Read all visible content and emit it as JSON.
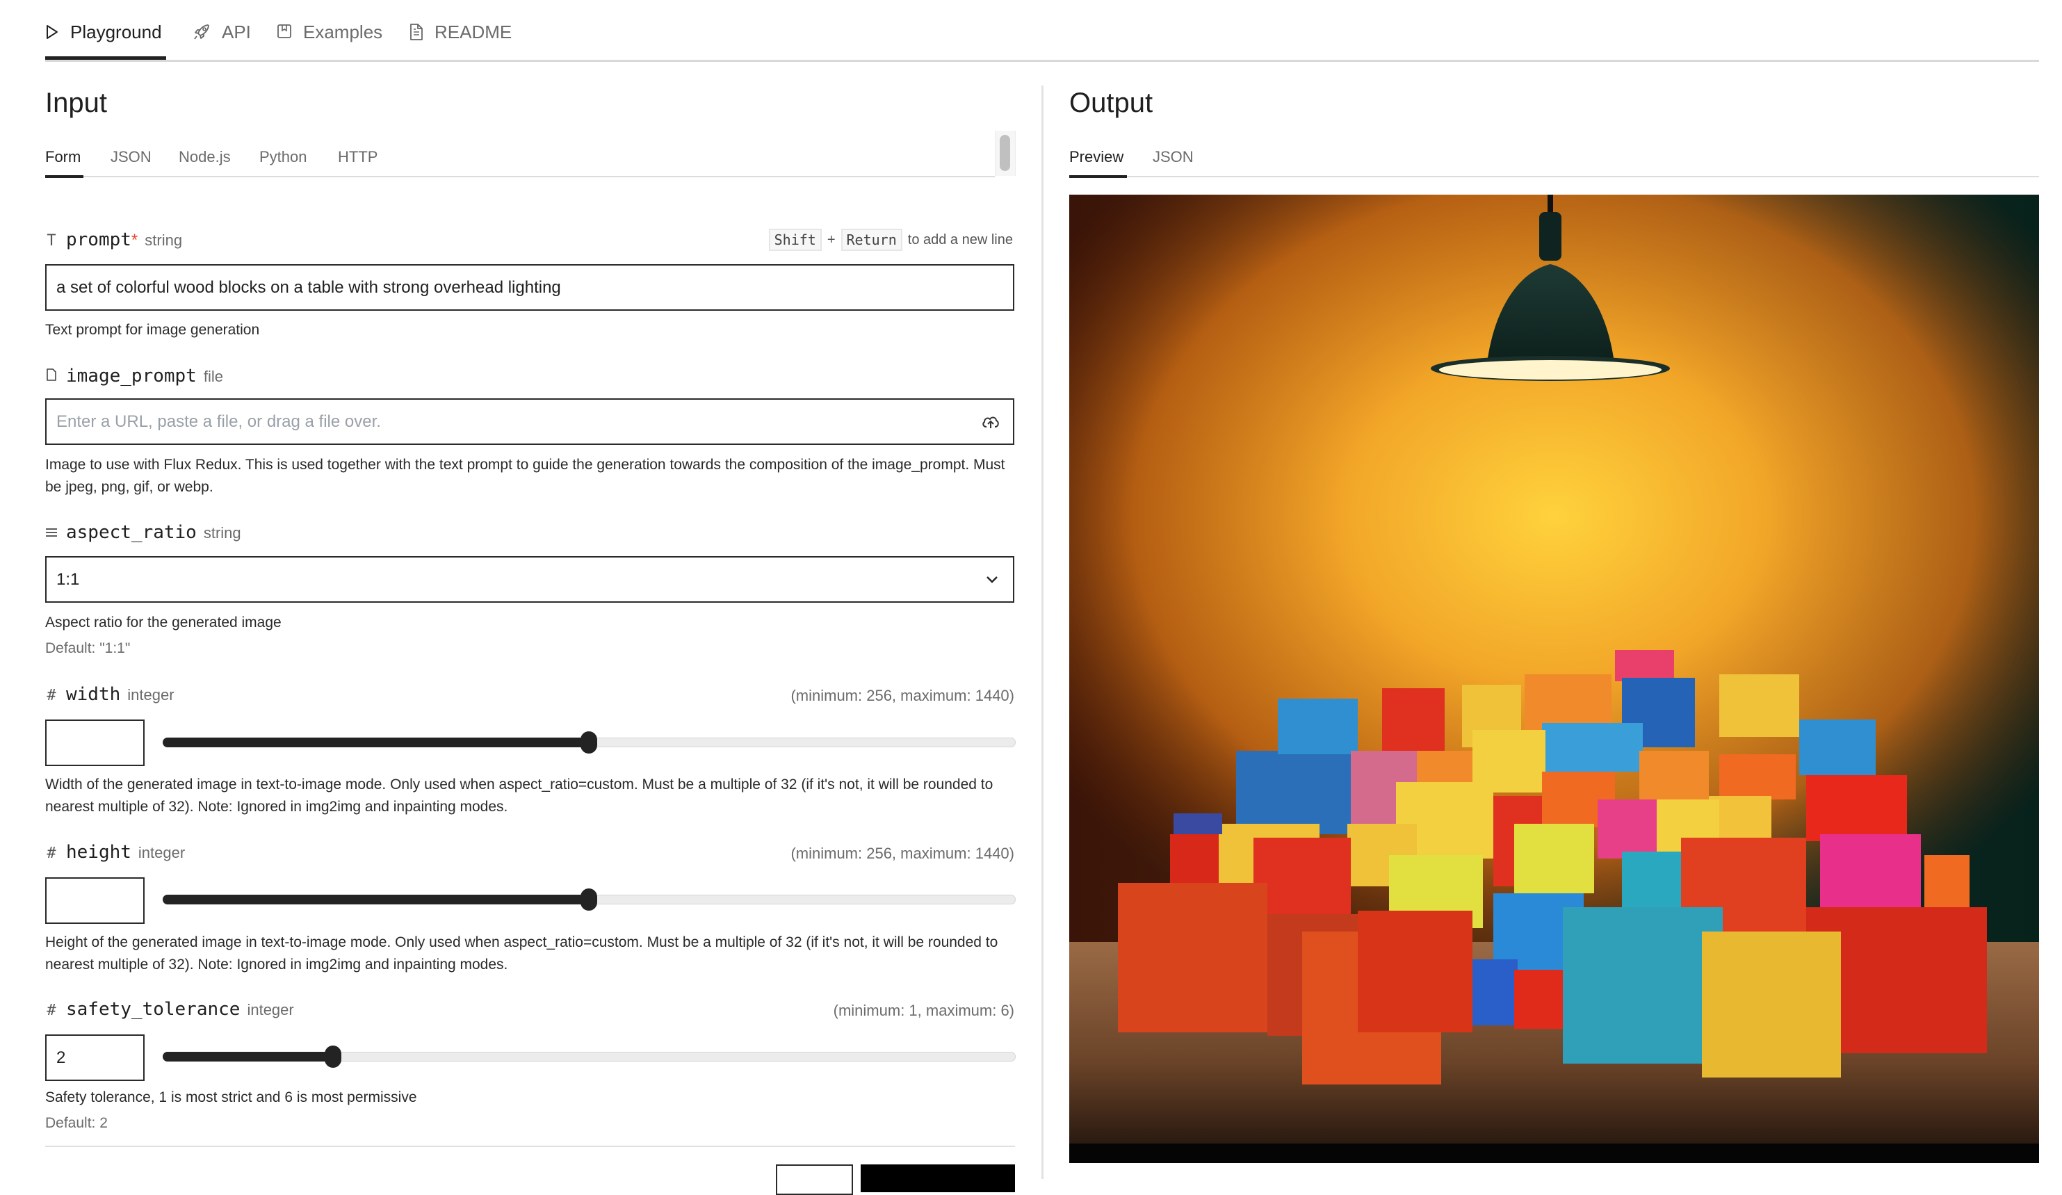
{
  "nav": {
    "tabs": [
      {
        "label": "Playground",
        "icon": "play-icon",
        "active": true
      },
      {
        "label": "API",
        "icon": "rocket-icon",
        "active": false
      },
      {
        "label": "Examples",
        "icon": "bookmark-icon",
        "active": false
      },
      {
        "label": "README",
        "icon": "document-icon",
        "active": false
      }
    ]
  },
  "input": {
    "title": "Input",
    "tabs": [
      {
        "label": "Form",
        "active": true
      },
      {
        "label": "JSON",
        "active": false
      },
      {
        "label": "Node.js",
        "active": false
      },
      {
        "label": "Python",
        "active": false
      },
      {
        "label": "HTTP",
        "active": false
      }
    ],
    "fields": {
      "prompt": {
        "icon": "text-type-icon",
        "name": "prompt",
        "required_mark": "*",
        "type": "string",
        "value": "a set of colorful wood blocks on a table with strong overhead lighting",
        "hint_key1": "Shift",
        "hint_plus": "+",
        "hint_key2": "Return",
        "hint_text": "to add a new line",
        "description": "Text prompt for image generation"
      },
      "image_prompt": {
        "icon": "file-icon",
        "name": "image_prompt",
        "type": "file",
        "placeholder": "Enter a URL, paste a file, or drag a file over.",
        "upload_icon": "cloud-upload-icon",
        "description": "Image to use with Flux Redux. This is used together with the text prompt to guide the generation towards the composition of the image_prompt. Must be jpeg, png, gif, or webp."
      },
      "aspect_ratio": {
        "icon": "list-icon",
        "name": "aspect_ratio",
        "type": "string",
        "value": "1:1",
        "description": "Aspect ratio for the generated image",
        "default": "Default: \"1:1\""
      },
      "width": {
        "icon": "hash-icon",
        "name": "width",
        "type": "integer",
        "range": "(minimum: 256, maximum: 1440)",
        "value": "",
        "slider_fraction": 0.5,
        "description": "Width of the generated image in text-to-image mode. Only used when aspect_ratio=custom. Must be a multiple of 32 (if it's not, it will be rounded to nearest multiple of 32). Note: Ignored in img2img and inpainting modes."
      },
      "height": {
        "icon": "hash-icon",
        "name": "height",
        "type": "integer",
        "range": "(minimum: 256, maximum: 1440)",
        "value": "",
        "slider_fraction": 0.5,
        "description": "Height of the generated image in text-to-image mode. Only used when aspect_ratio=custom. Must be a multiple of 32 (if it's not, it will be rounded to nearest multiple of 32). Note: Ignored in img2img and inpainting modes."
      },
      "safety_tolerance": {
        "icon": "hash-icon",
        "name": "safety_tolerance",
        "type": "integer",
        "range": "(minimum: 1, maximum: 6)",
        "value": "2",
        "slider_fraction": 0.2,
        "description": "Safety tolerance, 1 is most strict and 6 is most permissive",
        "default": "Default: 2"
      }
    }
  },
  "output": {
    "title": "Output",
    "tabs": [
      {
        "label": "Preview",
        "active": true
      },
      {
        "label": "JSON",
        "active": false
      }
    ],
    "image_description": "Colorful painted wooden blocks piled on a rustic wooden table under a dark pendant lamp against a warm orange wall"
  }
}
